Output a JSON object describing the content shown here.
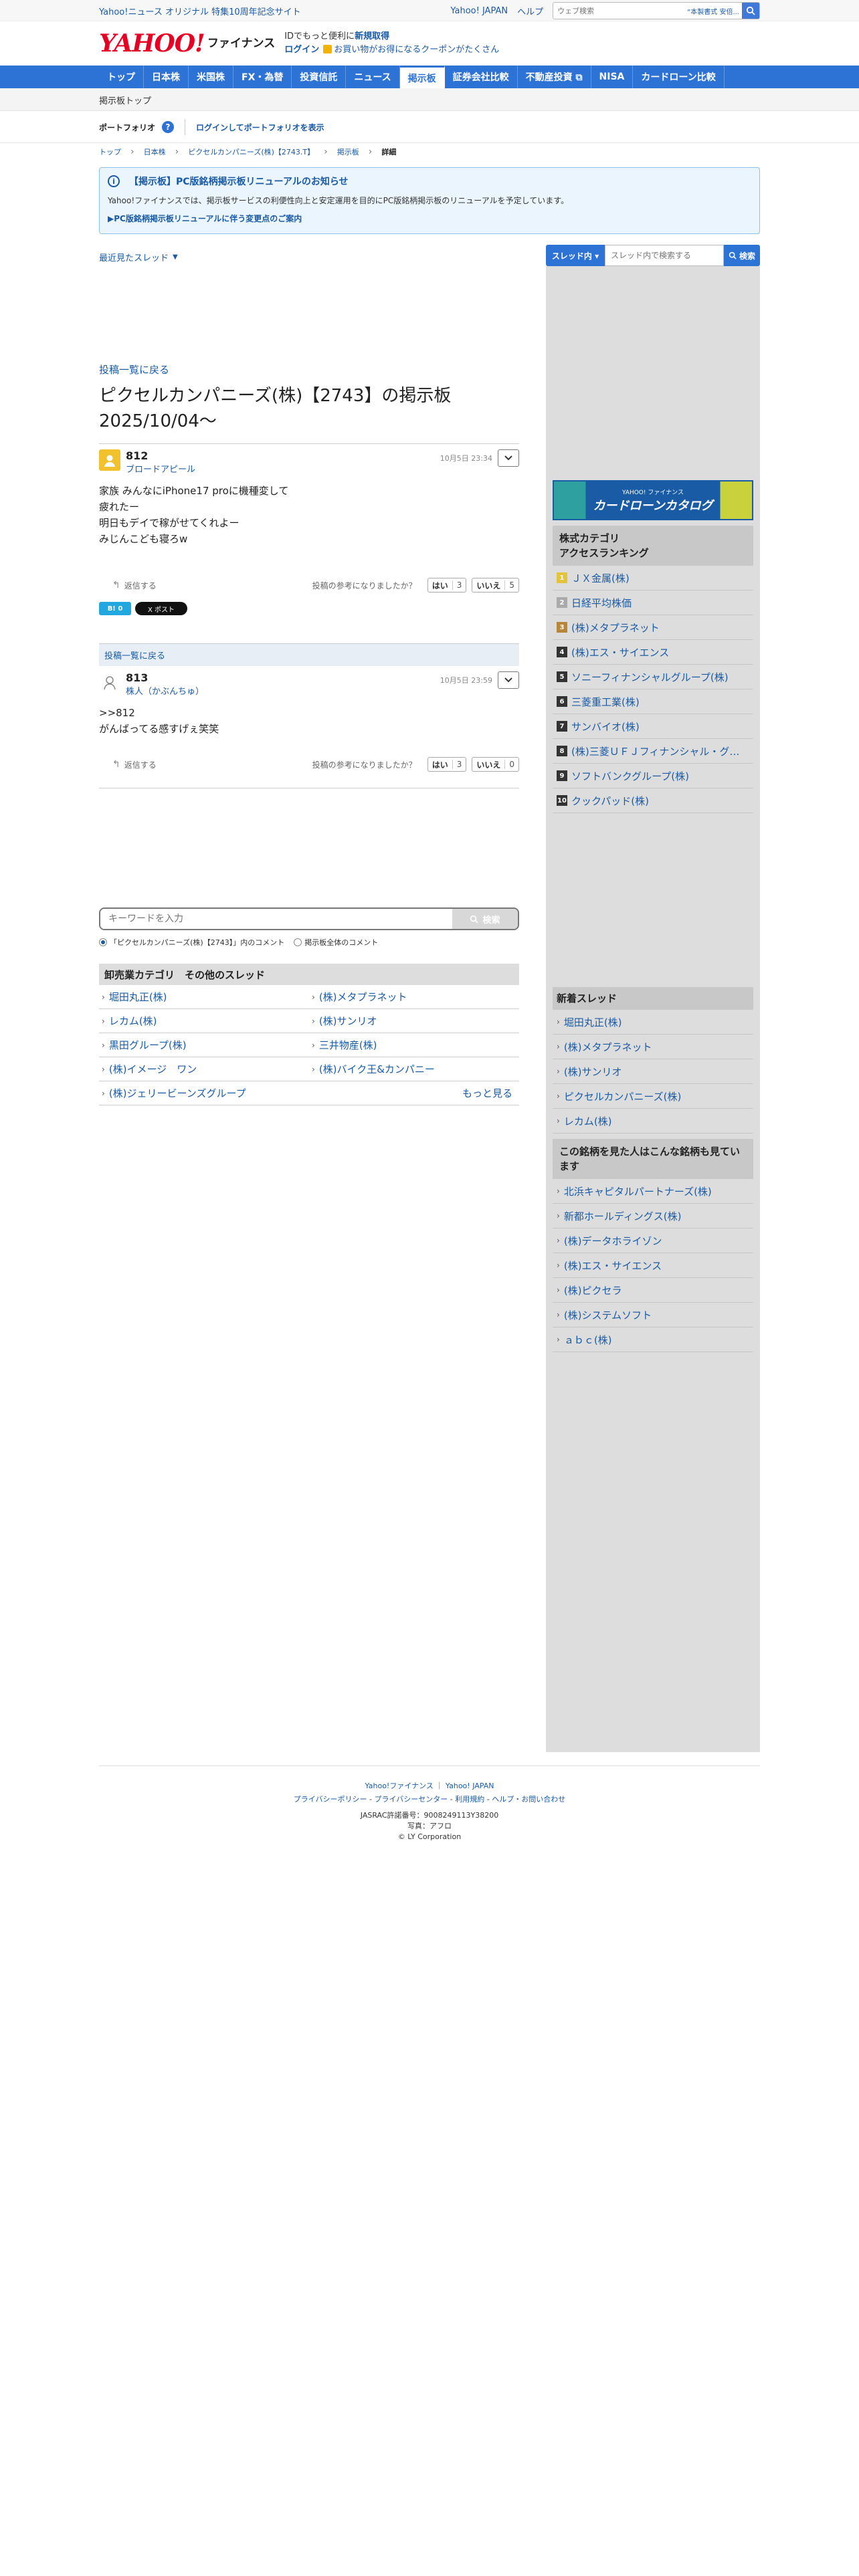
{
  "topbar": {
    "promo": "Yahoo!ニュース オリジナル 特集10周年記念サイト",
    "links": [
      "Yahoo! JAPAN",
      "ヘルプ"
    ],
    "search_placeholder": "ウェブ検索",
    "search_hint": "“本製書式 安倍..."
  },
  "header": {
    "logo_text": "YAHOO!",
    "logo_sub": "ファイナンス",
    "tagline_prefix": "IDでもっと便利に",
    "tagline_link": "新規取得",
    "login": "ログイン",
    "coupon": "お買い物がお得になるクーポンがたくさん"
  },
  "nav": {
    "items": [
      "トップ",
      "日本株",
      "米国株",
      "FX・為替",
      "投資信託",
      "ニュース",
      "掲示板",
      "証券会社比較",
      "不動産投資 ⧉",
      "NISA",
      "カードローン比較"
    ],
    "active_index": 6
  },
  "subnav": {
    "label": "掲示板トップ"
  },
  "portfolio": {
    "label": "ポートフォリオ",
    "help": "?",
    "login_link": "ログインしてポートフォリオを表示"
  },
  "breadcrumb": {
    "items": [
      "トップ",
      "日本株",
      "ピクセルカンパニーズ(株)【2743.T】",
      "掲示板"
    ],
    "current": "詳細"
  },
  "notice": {
    "title": "【掲示板】PC版銘柄掲示板リニューアルのお知らせ",
    "desc": "Yahoo!ファイナンスでは、掲示板サービスの利便性向上と安定運用を目的にPC版銘柄掲示板のリニューアルを予定しています。",
    "link": "▶PC版銘柄掲示板リニューアルに伴う変更点のご案内"
  },
  "main": {
    "recent": "最近見たスレッド",
    "back_to_list": "投稿一覧に戻る",
    "board_title": "ピクセルカンパニーズ(株)【2743】の掲示板 2025/10/04〜",
    "posts": [
      {
        "num": "812",
        "user": "ブロードアピール",
        "time": "10月5日 23:34",
        "body": "家族 みんなにiPhone17 proに機種変して\n疲れたー\n明日もデイで稼がせてくれよー\nみじんこども寝ろw",
        "reply": "返信する",
        "question": "投稿の参考になりましたか？",
        "yes": "はい",
        "yes_count": "3",
        "no": "いいえ",
        "no_count": "5",
        "avatar_color": "#f2c12e"
      },
      {
        "num": "813",
        "user": "株人（かぶんちゅ）",
        "time": "10月5日 23:59",
        "body": ">>812\nがんばってる感すげぇ笑笑",
        "reply": "返信する",
        "question": "投稿の参考になりましたか？",
        "yes": "はい",
        "yes_count": "3",
        "no": "いいえ",
        "no_count": "0",
        "avatar_color": "#ffffff"
      }
    ],
    "share": {
      "hatena": "B! 0",
      "x": "X ポスト"
    },
    "keyword": {
      "placeholder": "キーワードを入力",
      "button": "検索",
      "radio_in": "「ピクセルカンパニーズ(株)【2743】」内のコメント",
      "radio_all": "掲示板全体のコメント"
    },
    "other_threads": {
      "title": "卸売業カテゴリ　その他のスレッド",
      "items": [
        "堀田丸正(株)",
        "(株)メタプラネット",
        "レカム(株)",
        "(株)サンリオ",
        "黒田グループ(株)",
        "三井物産(株)",
        "(株)イメージ　ワン",
        "(株)バイク王&カンパニー",
        "(株)ジェリービーンズグループ"
      ],
      "more": "もっと見る"
    }
  },
  "side": {
    "search_scope": "スレッド内 ▾",
    "search_placeholder": "スレッド内で検索する",
    "search_button": "検索",
    "banner_small": "YAHOO! ファイナンス",
    "banner_title": "カードローンカタログ",
    "ranking_title": "株式カテゴリ\nアクセスランキング",
    "ranking": [
      "ＪＸ金属(株)",
      "日経平均株価",
      "(株)メタプラネット",
      "(株)エス・サイエンス",
      "ソニーフィナンシャルグループ(株)",
      "三菱重工業(株)",
      "サンバイオ(株)",
      "(株)三菱ＵＦＪフィナンシャル・グ…",
      "ソフトバンクグループ(株)",
      "クックパッド(株)"
    ],
    "new_title": "新着スレッド",
    "new_threads": [
      "堀田丸正(株)",
      "(株)メタプラネット",
      "(株)サンリオ",
      "ピクセルカンパニーズ(株)",
      "レカム(株)"
    ],
    "also_title": "この銘柄を見た人はこんな銘柄も見ています",
    "also": [
      "北浜キャピタルパートナーズ(株)",
      "新都ホールディングス(株)",
      "(株)データホライゾン",
      "(株)エス・サイエンス",
      "(株)ピクセラ",
      "(株)システムソフト",
      "ａｂｃ(株)"
    ]
  },
  "footer": {
    "line1": [
      "Yahoo!ファイナンス",
      "Yahoo! JAPAN"
    ],
    "line2": [
      "プライバシーポリシー",
      "プライバシーセンター",
      "利用規約",
      "ヘルプ・お問い合わせ"
    ],
    "jasrac": "JASRAC許諾番号：9008249113Y38200",
    "photo": "写真：アフロ",
    "copyright": "© LY Corporation"
  }
}
